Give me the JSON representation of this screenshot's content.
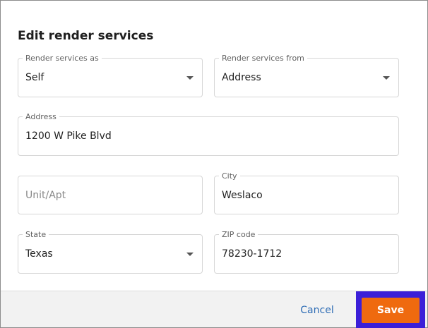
{
  "dialog": {
    "title": "Edit render services"
  },
  "fields": {
    "render_as": {
      "label": "Render services as",
      "value": "Self"
    },
    "render_from": {
      "label": "Render services from",
      "value": "Address"
    },
    "address": {
      "label": "Address",
      "value": "1200 W Pike Blvd"
    },
    "unit": {
      "placeholder": "Unit/Apt",
      "value": ""
    },
    "city": {
      "label": "City",
      "value": "Weslaco"
    },
    "state": {
      "label": "State",
      "value": "Texas"
    },
    "zip": {
      "label": "ZIP code",
      "value": "78230-1712"
    }
  },
  "footer": {
    "cancel_label": "Cancel",
    "save_label": "Save"
  },
  "colors": {
    "save_button": "#ef6a0f",
    "save_focus_ring": "#3b1fd8",
    "cancel_link": "#2f6db5"
  },
  "icons": {
    "dropdown": "chevron-down-icon"
  }
}
